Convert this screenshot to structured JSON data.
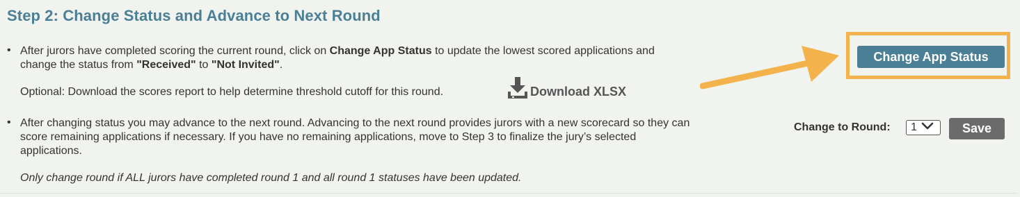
{
  "step": {
    "title": "Step 2: Change Status and Advance to Next Round"
  },
  "bullet1": {
    "marker": "•",
    "text_1": "After jurors have completed scoring the current round, click on ",
    "bold_1": "Change App Status",
    "text_2": " to update the lowest scored applications and",
    "text_3": "change the status from ",
    "bold_2": "\"Received\"",
    "text_4": " to ",
    "bold_3": "\"Not Invited\"",
    "text_5": ".",
    "optional": "Optional: Download the scores report to help determine threshold cutoff for this round.",
    "download_label": "Download XLSX",
    "download_icon": "download-icon"
  },
  "bullet2": {
    "marker": "•",
    "line_1": "After changing status you may advance to the next round. Advancing to the next round provides jurors with a new scorecard so they can",
    "line_2": "score remaining applications if necessary. If you have no remaining applications, move to Step 3 to finalize the jury’s selected",
    "line_3": "applications.",
    "note": "Only change round if ALL jurors have completed round 1 and all round 1 statuses have been updated."
  },
  "actions": {
    "change_status_label": "Change App Status",
    "round_label": "Change to Round:",
    "round_value": "1",
    "save_label": "Save"
  },
  "colors": {
    "accent": "#4a7f96",
    "highlight": "#f3b24b",
    "save_button": "#6b6b6b",
    "background": "#f1f3ee"
  }
}
